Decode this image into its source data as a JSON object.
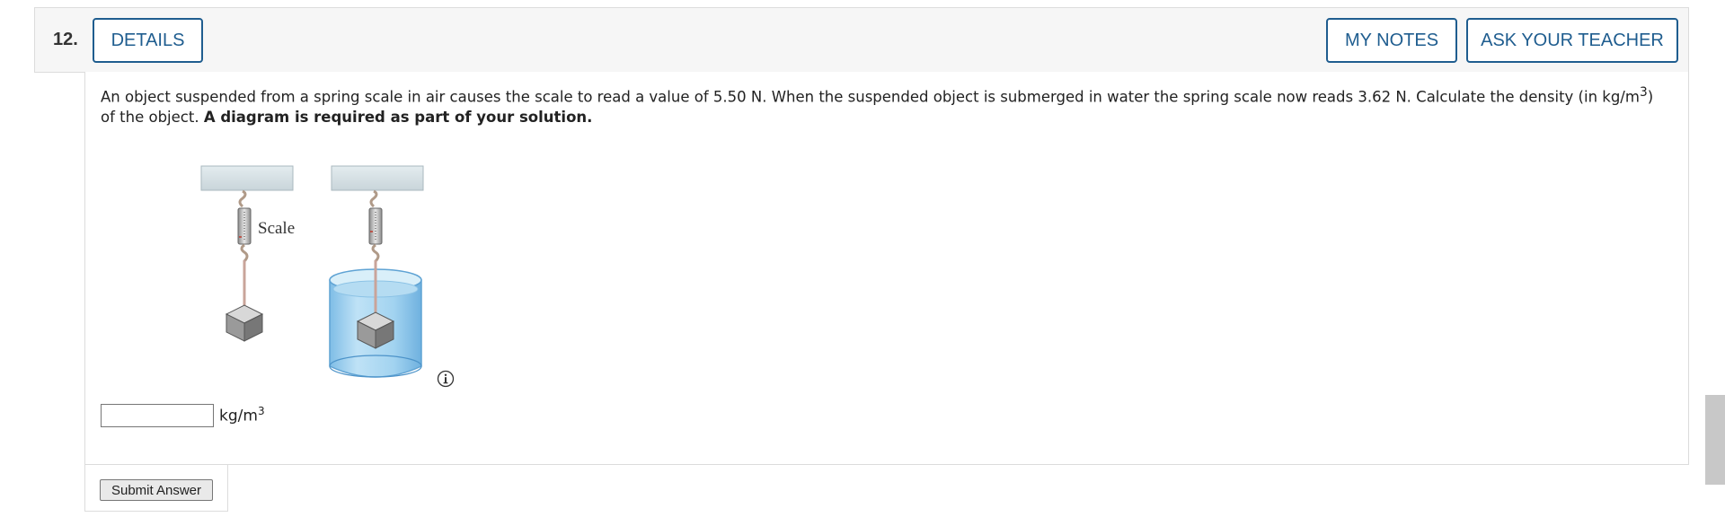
{
  "header": {
    "question_number": "12.",
    "details_label": "DETAILS",
    "my_notes_label": "MY NOTES",
    "ask_teacher_label": "ASK YOUR TEACHER"
  },
  "question": {
    "text_before_exponent": "An object suspended from a spring scale in air causes the scale to read a value of 5.50 N. When the suspended object is submerged in water the spring scale now reads 3.62 N. Calculate the density (in kg/m",
    "exponent": "3",
    "text_after_exponent": ") of the object. ",
    "bold_text": "A diagram is required as part of your solution."
  },
  "diagram": {
    "scale_label": "Scale"
  },
  "answer": {
    "value": "",
    "unit_base": "kg/m",
    "unit_exponent": "3"
  },
  "submit_label": "Submit Answer",
  "colors": {
    "accent": "#1f5d8f",
    "water": "#9fd0ee"
  }
}
